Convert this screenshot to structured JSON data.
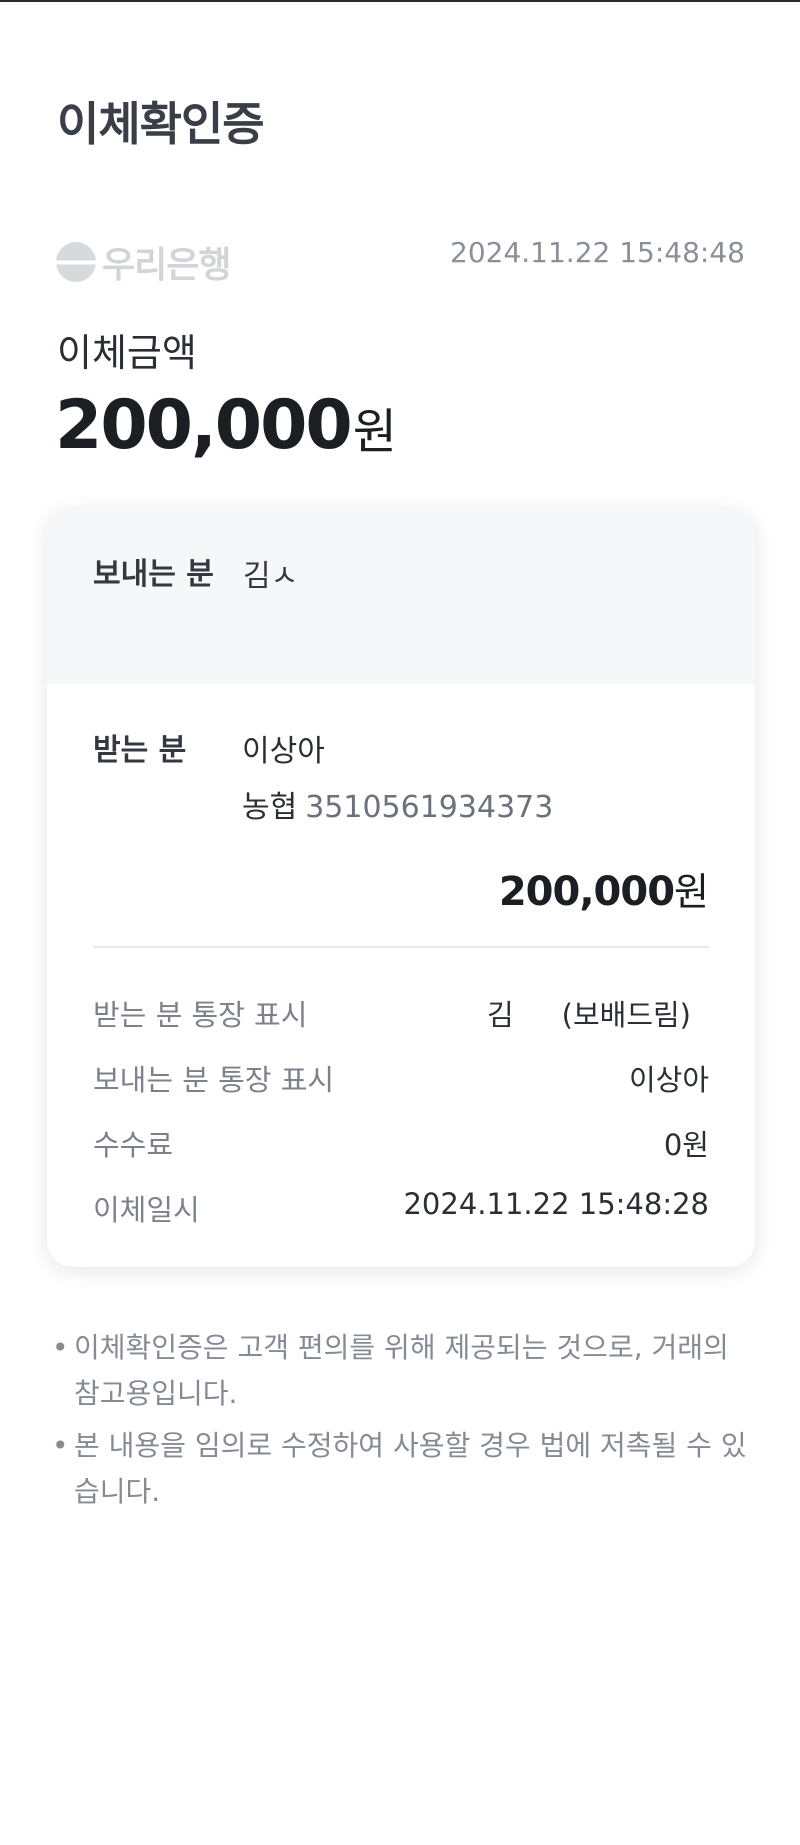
{
  "header": {
    "title": "이체확인증"
  },
  "bank": {
    "name": "우리은행",
    "issued_at": "2024.11.22 15:48:48"
  },
  "amount": {
    "label": "이체금액",
    "value": "200,000",
    "unit": "원"
  },
  "sender": {
    "label": "보내는 분",
    "name": "김ㅅ"
  },
  "receiver": {
    "label": "받는 분",
    "name": "이상아",
    "bank": "농협",
    "account": "3510561934373",
    "amount_value": "200,000",
    "amount_unit": "원"
  },
  "details": [
    {
      "key": "받는 분 통장 표시",
      "value_a": "김",
      "value_b": "(보배드림)"
    },
    {
      "key": "보내는 분 통장 표시",
      "value": "이상아"
    },
    {
      "key": "수수료",
      "value": "0원"
    },
    {
      "key": "이체일시",
      "value": "2024.11.22 15:48:28"
    }
  ],
  "notes": [
    "이체확인증은 고객 편의를 위해 제공되는 것으로, 거래의 참고용입니다.",
    "본 내용을 임의로 수정하여 사용할 경우 법에 저촉될 수 있습니다."
  ],
  "colors": {
    "background": "#ffffff",
    "card_shadow": "#e6e8eb",
    "sender_bg": "#f6f7f9",
    "muted_text": "#7c828b"
  }
}
